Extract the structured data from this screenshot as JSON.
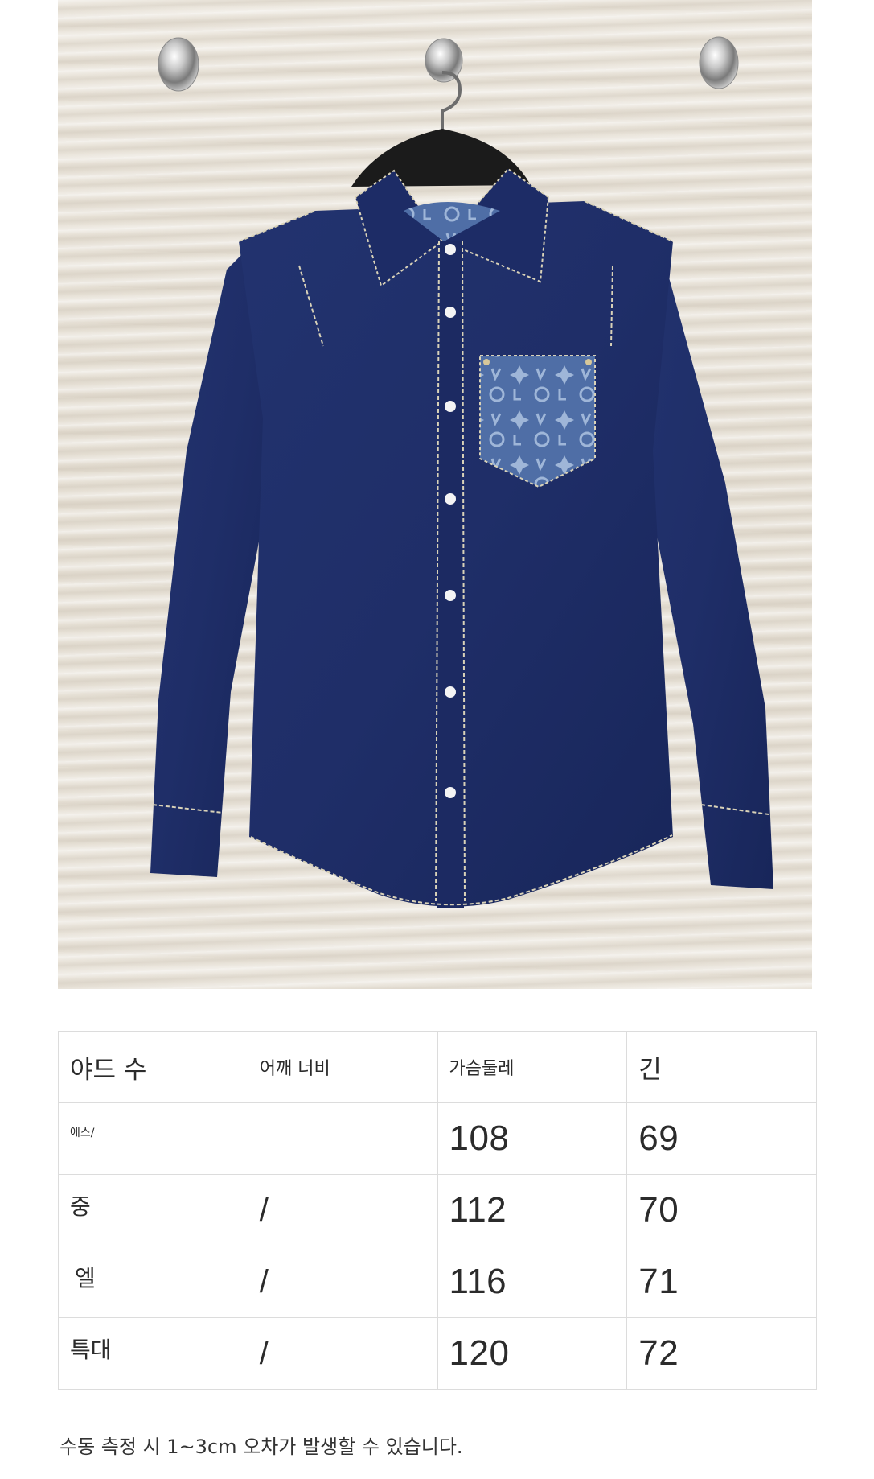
{
  "colors": {
    "denim": "#1f2f6e",
    "denim_dark": "#15224f",
    "stitch": "#d9d2b8",
    "monogram_pocket": "#5a7bb0",
    "wall": "#e8e3da",
    "border": "#dcdcdc"
  },
  "photo": {
    "subject": "denim-shirt-on-hanger",
    "icons": [
      "wall-knob-icon",
      "hanger-icon",
      "monogram-pocket-icon"
    ]
  },
  "size_table": {
    "headers": [
      "야드 수",
      "어깨 너비",
      "가슴둘레",
      "긴"
    ],
    "rows": [
      {
        "size": "에스/",
        "shoulder": "",
        "chest": "108",
        "length": "69"
      },
      {
        "size": "중",
        "shoulder": "/",
        "chest": "112",
        "length": "70"
      },
      {
        "size": "엘",
        "shoulder": "/",
        "chest": "116",
        "length": "71"
      },
      {
        "size": "특대",
        "shoulder": "/",
        "chest": "120",
        "length": "72"
      }
    ]
  },
  "note": "수동 측정 시 1~3cm 오차가 발생할 수 있습니다."
}
